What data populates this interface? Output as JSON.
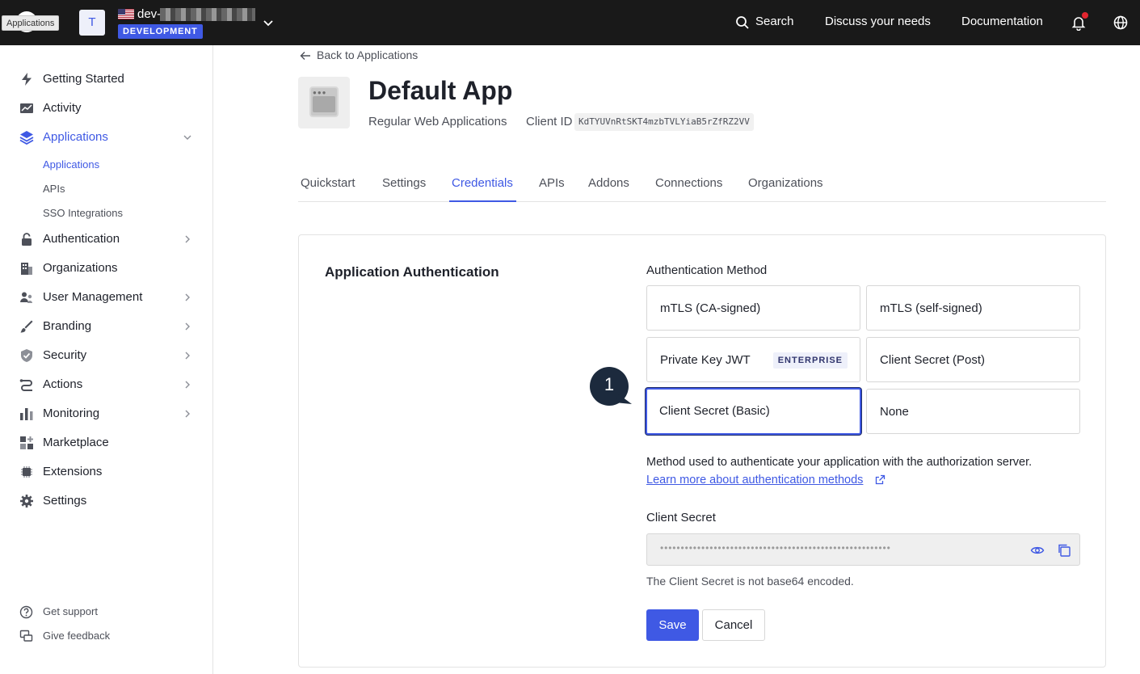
{
  "topbar": {
    "tooltip": "Applications",
    "tenant_initial": "T",
    "tenant_name": "dev-",
    "environment": "DEVELOPMENT",
    "search_label": "Search",
    "discuss_label": "Discuss your needs",
    "docs_label": "Documentation"
  },
  "sidebar": {
    "items": [
      {
        "label": "Getting Started",
        "icon": "lightning-icon"
      },
      {
        "label": "Activity",
        "icon": "activity-chart-icon"
      },
      {
        "label": "Applications",
        "icon": "layers-icon",
        "active": true,
        "expanded": true
      },
      {
        "label": "Authentication",
        "icon": "lock-icon"
      },
      {
        "label": "Organizations",
        "icon": "building-icon"
      },
      {
        "label": "User Management",
        "icon": "users-icon"
      },
      {
        "label": "Branding",
        "icon": "brush-icon"
      },
      {
        "label": "Security",
        "icon": "shield-check-icon"
      },
      {
        "label": "Actions",
        "icon": "actions-flow-icon"
      },
      {
        "label": "Monitoring",
        "icon": "bar-chart-icon"
      },
      {
        "label": "Marketplace",
        "icon": "grid-plus-icon"
      },
      {
        "label": "Extensions",
        "icon": "extension-icon"
      },
      {
        "label": "Settings",
        "icon": "gear-icon"
      }
    ],
    "sub_items": [
      {
        "label": "Applications",
        "active": true
      },
      {
        "label": "APIs"
      },
      {
        "label": "SSO Integrations"
      }
    ],
    "footer": [
      {
        "label": "Get support",
        "icon": "help-circle-icon"
      },
      {
        "label": "Give feedback",
        "icon": "feedback-icon"
      }
    ]
  },
  "main": {
    "back_label": "Back to Applications",
    "app_title": "Default App",
    "app_type": "Regular Web Applications",
    "client_id_label": "Client ID",
    "client_id": "KdTYUVnRtSKT4mzbTVLYiaB5rZfRZ2VV",
    "tabs": [
      "Quickstart",
      "Settings",
      "Credentials",
      "APIs",
      "Addons",
      "Connections",
      "Organizations"
    ],
    "active_tab": "Credentials"
  },
  "credentials": {
    "section_title": "Application Authentication",
    "method_label": "Authentication Method",
    "options": [
      {
        "label": "mTLS (CA-signed)"
      },
      {
        "label": "mTLS (self-signed)"
      },
      {
        "label": "Private Key JWT",
        "badge": "ENTERPRISE"
      },
      {
        "label": "Client Secret (Post)"
      },
      {
        "label": "Client Secret (Basic)",
        "selected": true
      },
      {
        "label": "None"
      }
    ],
    "help_text": "Method used to authenticate your application with the authorization server.",
    "help_link": "Learn more about authentication methods",
    "secret_label": "Client Secret",
    "secret_masked": "••••••••••••••••••••••••••••••••••••••••••••••••••••••••",
    "secret_note": "The Client Secret is not base64 encoded.",
    "save_label": "Save",
    "cancel_label": "Cancel"
  },
  "annotation": {
    "step": "1"
  },
  "colors": {
    "accent": "#3f59e4",
    "topbar": "#191919",
    "notification": "#e2252f"
  }
}
